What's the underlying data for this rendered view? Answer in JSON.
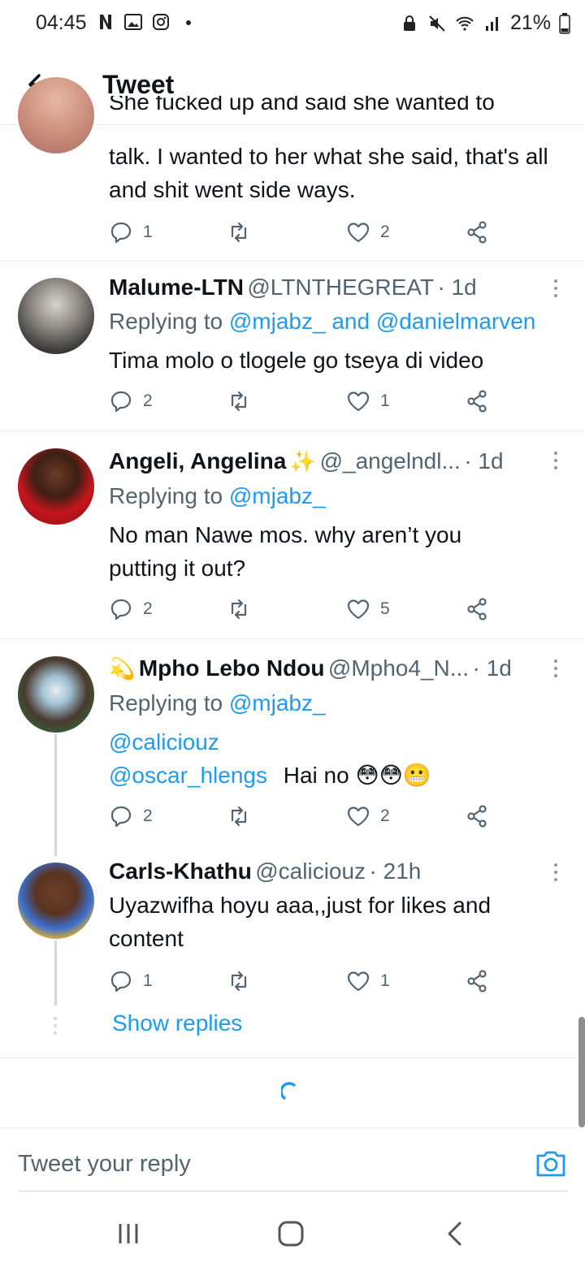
{
  "status_bar": {
    "time": "04:45",
    "battery": "21%"
  },
  "header": {
    "title": "Tweet"
  },
  "tweets": [
    {
      "text_partial": "She fucked up and said she wanted to",
      "text": "talk. I wanted to her what she said, that's all and shit went side ways.",
      "replies": "1",
      "likes": "2"
    },
    {
      "name": "Malume-LTN",
      "handle": "@LTNTHEGREAT",
      "time": "· 1d",
      "replying_prefix": "Replying to",
      "replying_to": "@mjabz_",
      "replying_and": "and",
      "replying_to_2": "@danielmarven",
      "text": "Tima molo o tlogele go tseya di video",
      "replies": "2",
      "likes": "1"
    },
    {
      "name": "Angeli, Angelina",
      "emoji": "✨",
      "handle": "@_angelndl...",
      "time": "· 1d",
      "replying_prefix": "Replying to",
      "replying_to": "@mjabz_",
      "text": "No man Nawe mos. why aren’t you putting it out?",
      "replies": "2",
      "likes": "5"
    },
    {
      "name_emoji": "💫",
      "name": "Mpho Lebo Ndou",
      "handle": "@Mpho4_N...",
      "time": "· 1d",
      "replying_prefix": "Replying to",
      "replying_to": "@mjabz_",
      "mention_1": "@caliciouz",
      "mention_2": "@oscar_hlengs",
      "text": "Hai no",
      "text_emojis": "😳😳😬",
      "replies": "2",
      "likes": "2"
    },
    {
      "name": "Carls-Khathu",
      "handle": "@caliciouz",
      "time": "· 21h",
      "text": "Uyazwifha hoyu aaa,,just for likes and content",
      "replies": "1",
      "likes": "1"
    }
  ],
  "show_replies": "Show replies",
  "composer": {
    "placeholder": "Tweet your reply"
  },
  "colors": {
    "link": "#1d9bf0",
    "secondary_text": "#536471",
    "divider": "#e6ecf0"
  },
  "icons": [
    "back-arrow-icon",
    "reply-icon",
    "retweet-icon",
    "like-icon",
    "share-icon",
    "more-icon",
    "camera-icon",
    "loading-spinner-icon"
  ]
}
